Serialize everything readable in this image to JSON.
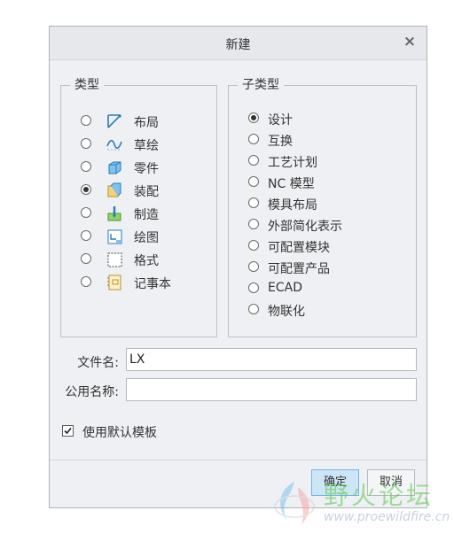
{
  "dialog": {
    "title": "新建",
    "close_glyph": "×"
  },
  "type_group": {
    "legend": "类型",
    "items": [
      {
        "label": "布局",
        "icon": "layout-icon",
        "selected": false
      },
      {
        "label": "草绘",
        "icon": "sketch-icon",
        "selected": false
      },
      {
        "label": "零件",
        "icon": "part-icon",
        "selected": false
      },
      {
        "label": "装配",
        "icon": "assembly-icon",
        "selected": true
      },
      {
        "label": "制造",
        "icon": "manufacturing-icon",
        "selected": false
      },
      {
        "label": "绘图",
        "icon": "drawing-icon",
        "selected": false
      },
      {
        "label": "格式",
        "icon": "format-icon",
        "selected": false
      },
      {
        "label": "记事本",
        "icon": "notebook-icon",
        "selected": false
      }
    ]
  },
  "subtype_group": {
    "legend": "子类型",
    "items": [
      {
        "label": "设计",
        "selected": true
      },
      {
        "label": "互换",
        "selected": false
      },
      {
        "label": "工艺计划",
        "selected": false
      },
      {
        "label": "NC 模型",
        "selected": false
      },
      {
        "label": "模具布局",
        "selected": false
      },
      {
        "label": "外部简化表示",
        "selected": false
      },
      {
        "label": "可配置模块",
        "selected": false
      },
      {
        "label": "可配置产品",
        "selected": false
      },
      {
        "label": "ECAD",
        "selected": false
      },
      {
        "label": "物联化",
        "selected": false
      }
    ]
  },
  "form": {
    "filename_label": "文件名:",
    "filename_value": "LX",
    "common_name_label": "公用名称:",
    "common_name_value": ""
  },
  "use_default_template": {
    "label": "使用默认模板",
    "checked": true
  },
  "buttons": {
    "ok": "确定",
    "cancel": "取消"
  },
  "watermark": {
    "text": "野火论坛",
    "url": "www.proewildfire.cn"
  },
  "colors": {
    "accent": "#72b5e6",
    "icon_blue": "#2a7ab8",
    "icon_green": "#4a9a2e"
  }
}
